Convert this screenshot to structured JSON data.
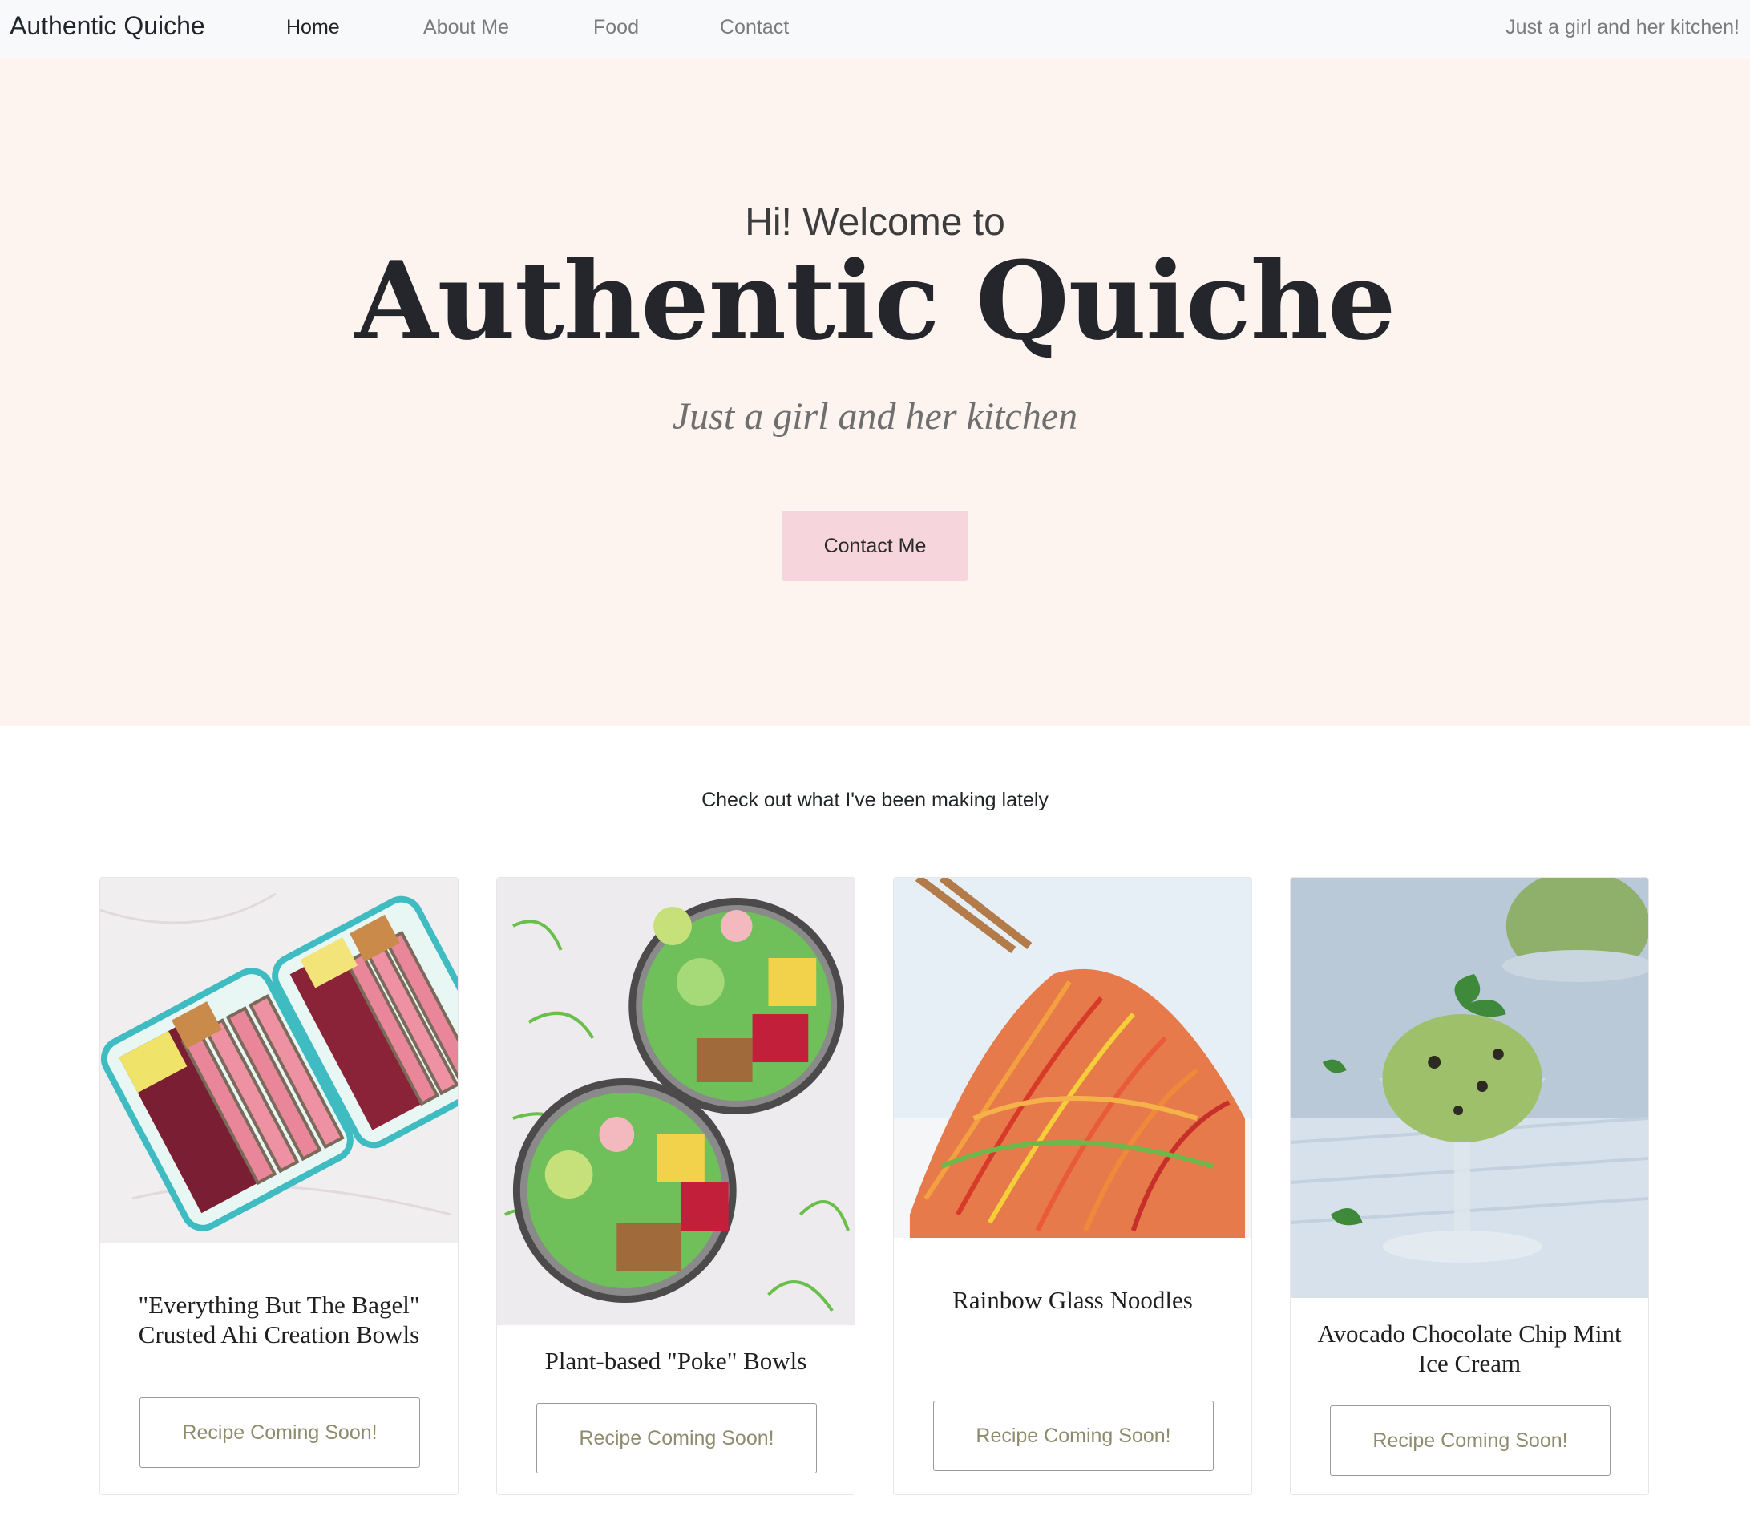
{
  "nav": {
    "brand": "Authentic Quiche",
    "links": [
      "Home",
      "About Me",
      "Food",
      "Contact"
    ],
    "tagline": "Just a girl and her kitchen!"
  },
  "hero": {
    "pre_title": "Hi! Welcome to",
    "title": "Authentic Quiche",
    "script": "Just a girl and her kitchen",
    "cta": "Contact Me"
  },
  "section": {
    "heading": "Check out what I've been making lately"
  },
  "cards": [
    {
      "title": "\"Everything But The Bagel\" Crusted Ahi Creation Bowls",
      "button": "Recipe Coming Soon!",
      "image": "ahi-bowl-photo"
    },
    {
      "title": "Plant-based \"Poke\" Bowls",
      "button": "Recipe Coming Soon!",
      "image": "poke-bowl-photo"
    },
    {
      "title": "Rainbow Glass Noodles",
      "button": "Recipe Coming Soon!",
      "image": "glass-noodles-photo"
    },
    {
      "title": "Avocado Chocolate Chip Mint Ice Cream",
      "button": "Recipe Coming Soon!",
      "image": "ice-cream-photo"
    }
  ],
  "colors": {
    "navbar_bg": "#f8f9fa",
    "hero_bg": "#fdf4f0",
    "cta_bg": "#f6d6dc",
    "card_button_text": "#8f8c6e"
  }
}
